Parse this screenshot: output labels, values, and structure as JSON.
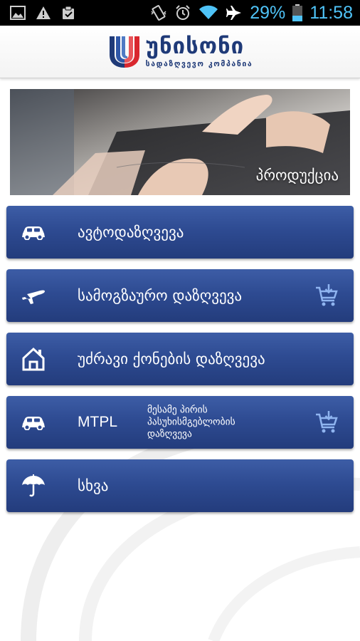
{
  "status_bar": {
    "battery": "29%",
    "time": "11:58",
    "icons": [
      "gallery-icon",
      "warning-icon",
      "clipboard-icon",
      "vibrate-icon",
      "alarm-icon",
      "wifi-icon",
      "airplane-icon",
      "battery-icon"
    ]
  },
  "header": {
    "logo_name": "უნისონი",
    "logo_subtitle": "სადაზღვევო კომპანია",
    "logo_icon": "unison-logo"
  },
  "banner": {
    "label": "პროდუქცია"
  },
  "menu": {
    "items": [
      {
        "label": "ავტოდაზღვევა",
        "icon": "car-icon",
        "cart": false
      },
      {
        "label": "სამოგზაურო დაზღვევა",
        "icon": "airplane-icon",
        "cart": true
      },
      {
        "label": "უძრავი ქონების დაზღვევა",
        "icon": "house-icon",
        "cart": false
      },
      {
        "label": "MTPL",
        "sublabel": "მესამე პირის პასუხისმგებლობის დაზღვევა",
        "icon": "car-icon",
        "cart": true
      },
      {
        "label": "სხვა",
        "icon": "umbrella-icon",
        "cart": false
      }
    ]
  },
  "colors": {
    "button_blue": "#2e4b92",
    "logo_blue": "#1f3a78",
    "logo_red": "#d9272e",
    "status_accent": "#4fc3f7"
  }
}
